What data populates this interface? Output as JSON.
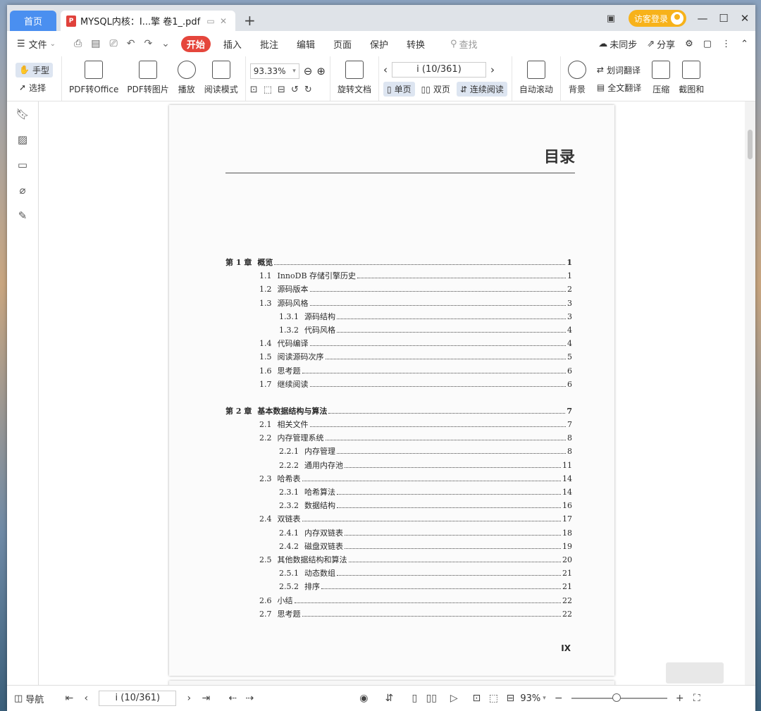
{
  "titlebar": {
    "home_tab": "首页",
    "doc_tab_icon": "P",
    "doc_tab_title": "MYSQL内核：I...擎 卷1_.pdf",
    "new_tab": "+",
    "guest_login": "访客登录"
  },
  "menubar": {
    "file": "文件",
    "items": [
      "开始",
      "插入",
      "批注",
      "编辑",
      "页面",
      "保护",
      "转换"
    ],
    "search_placeholder": "查找",
    "sync_status": "未同步",
    "share": "分享"
  },
  "ribbon": {
    "hand": "手型",
    "select": "选择",
    "pdf_to_office": "PDF转Office",
    "pdf_to_image": "PDF转图片",
    "play": "播放",
    "read_mode": "阅读模式",
    "zoom": "93.33%",
    "rotate_doc": "旋转文档",
    "page_indicator": "i (10/361)",
    "single_page": "单页",
    "double_page": "双页",
    "continuous": "连续阅读",
    "auto_scroll": "自动滚动",
    "background": "背景",
    "word_translate": "划词翻译",
    "full_translate": "全文翻译",
    "compress": "压缩",
    "screenshot": "截图和"
  },
  "page": {
    "heading": "目录",
    "footer_number": "IX",
    "toc": [
      {
        "num": "第 1 章",
        "title": "概览",
        "page": "1",
        "level": 0
      },
      {
        "num": "1.1",
        "title": "InnoDB 存储引擎历史",
        "page": "1",
        "level": 1
      },
      {
        "num": "1.2",
        "title": "源码版本",
        "page": "2",
        "level": 1
      },
      {
        "num": "1.3",
        "title": "源码风格",
        "page": "3",
        "level": 1
      },
      {
        "num": "1.3.1",
        "title": "源码结构",
        "page": "3",
        "level": 2
      },
      {
        "num": "1.3.2",
        "title": "代码风格",
        "page": "4",
        "level": 2
      },
      {
        "num": "1.4",
        "title": "代码编译",
        "page": "4",
        "level": 1
      },
      {
        "num": "1.5",
        "title": "阅读源码次序",
        "page": "5",
        "level": 1
      },
      {
        "num": "1.6",
        "title": "思考题",
        "page": "6",
        "level": 1
      },
      {
        "num": "1.7",
        "title": "继续阅读",
        "page": "6",
        "level": 1
      },
      {
        "num": "第 2 章",
        "title": "基本数据结构与算法",
        "page": "7",
        "level": 0
      },
      {
        "num": "2.1",
        "title": "相关文件",
        "page": "7",
        "level": 1
      },
      {
        "num": "2.2",
        "title": "内存管理系统",
        "page": "8",
        "level": 1
      },
      {
        "num": "2.2.1",
        "title": "内存管理",
        "page": "8",
        "level": 2
      },
      {
        "num": "2.2.2",
        "title": "通用内存池",
        "page": "11",
        "level": 2
      },
      {
        "num": "2.3",
        "title": "哈希表",
        "page": "14",
        "level": 1
      },
      {
        "num": "2.3.1",
        "title": "哈希算法",
        "page": "14",
        "level": 2
      },
      {
        "num": "2.3.2",
        "title": "数据结构",
        "page": "16",
        "level": 2
      },
      {
        "num": "2.4",
        "title": "双链表",
        "page": "17",
        "level": 1
      },
      {
        "num": "2.4.1",
        "title": "内存双链表",
        "page": "18",
        "level": 2
      },
      {
        "num": "2.4.2",
        "title": "磁盘双链表",
        "page": "19",
        "level": 2
      },
      {
        "num": "2.5",
        "title": "其他数据结构和算法",
        "page": "20",
        "level": 1
      },
      {
        "num": "2.5.1",
        "title": "动态数组",
        "page": "21",
        "level": 2
      },
      {
        "num": "2.5.2",
        "title": "排序",
        "page": "21",
        "level": 2
      },
      {
        "num": "2.6",
        "title": "小结",
        "page": "22",
        "level": 1
      },
      {
        "num": "2.7",
        "title": "思考题",
        "page": "22",
        "level": 1
      }
    ]
  },
  "statusbar": {
    "nav": "导航",
    "page_indicator": "i (10/361)",
    "zoom": "93%"
  }
}
